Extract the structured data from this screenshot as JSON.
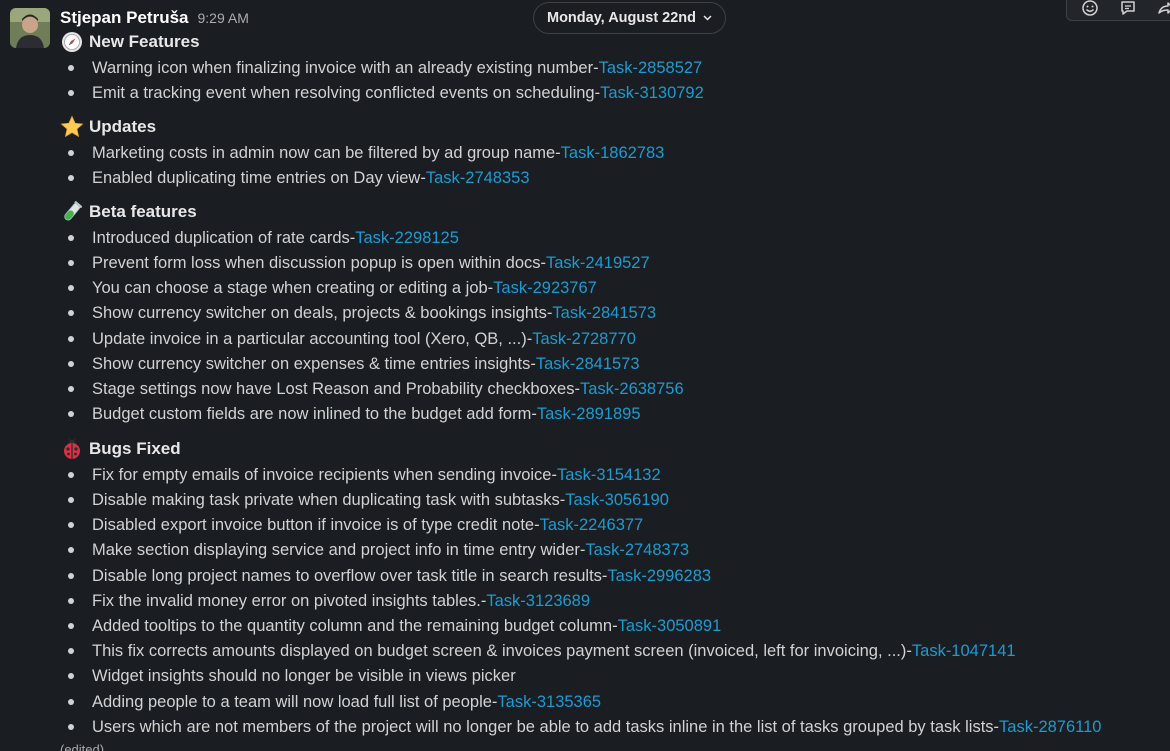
{
  "message": {
    "author": "Stjepan Petruša",
    "time": "9:29 AM",
    "edited_label": "(edited)"
  },
  "date_divider": {
    "label": "Monday, August 22nd",
    "icon": "chevron-down-icon"
  },
  "toolbar": {
    "icons": [
      "emoji-reaction-icon",
      "reply-in-thread-icon",
      "share-message-icon"
    ]
  },
  "separator": " - ",
  "sections": [
    {
      "title": "New Features",
      "icon": "compass-icon",
      "items": [
        {
          "text": "Warning icon when finalizing invoice with an already existing number",
          "task": "Task-2858527"
        },
        {
          "text": "Emit a tracking event when resolving conflicted events on scheduling",
          "task": "Task-3130792"
        }
      ]
    },
    {
      "title": "Updates",
      "icon": "star-icon",
      "items": [
        {
          "text": "Marketing costs in admin now can be filtered by ad group name",
          "task": "Task-1862783"
        },
        {
          "text": "Enabled duplicating time entries on Day view",
          "task": "Task-2748353"
        }
      ]
    },
    {
      "title": "Beta features",
      "icon": "test-tube-icon",
      "items": [
        {
          "text": "Introduced duplication of rate cards",
          "task": "Task-2298125"
        },
        {
          "text": "Prevent form loss when discussion popup is open within docs",
          "task": "Task-2419527"
        },
        {
          "text": "You can choose a stage when creating or editing a job",
          "task": "Task-2923767"
        },
        {
          "text": "Show currency switcher on deals, projects & bookings insights",
          "task": "Task-2841573"
        },
        {
          "text": "Update invoice in a particular accounting tool (Xero, QB, ...)",
          "task": "Task-2728770"
        },
        {
          "text": "Show currency switcher on expenses & time entries insights",
          "task": "Task-2841573"
        },
        {
          "text": "Stage settings now have Lost Reason and Probability checkboxes",
          "task": "Task-2638756"
        },
        {
          "text": "Budget custom fields are now inlined to the budget add form",
          "task": "Task-2891895"
        }
      ]
    },
    {
      "title": "Bugs Fixed",
      "icon": "ladybug-icon",
      "items": [
        {
          "text": "Fix for empty emails of invoice recipients when sending invoice",
          "task": "Task-3154132"
        },
        {
          "text": "Disable making task private when duplicating task with subtasks",
          "task": "Task-3056190"
        },
        {
          "text": "Disabled export invoice button if invoice is of type credit note",
          "task": "Task-2246377"
        },
        {
          "text": "Make section displaying service and project info in time entry wider",
          "task": "Task-2748373"
        },
        {
          "text": "Disable long project names to overflow over task title in search results",
          "task": "Task-2996283"
        },
        {
          "text": "Fix the invalid money error on pivoted insights tables.",
          "task": "Task-3123689"
        },
        {
          "text": "Added tooltips to the quantity column and the remaining budget column",
          "task": "Task-3050891"
        },
        {
          "text": "This fix corrects amounts displayed on budget screen & invoices payment screen (invoiced, left for invoicing, ...)",
          "task": "Task-1047141"
        },
        {
          "text": "Widget insights should no longer be visible in views picker",
          "task": ""
        },
        {
          "text": "Adding people to a team will now load full list of people",
          "task": "Task-3135365"
        },
        {
          "text": "Users which are not members of the project will no longer be able to add tasks inline in the list of tasks grouped by task lists",
          "task": "Task-2876110"
        }
      ]
    }
  ]
}
